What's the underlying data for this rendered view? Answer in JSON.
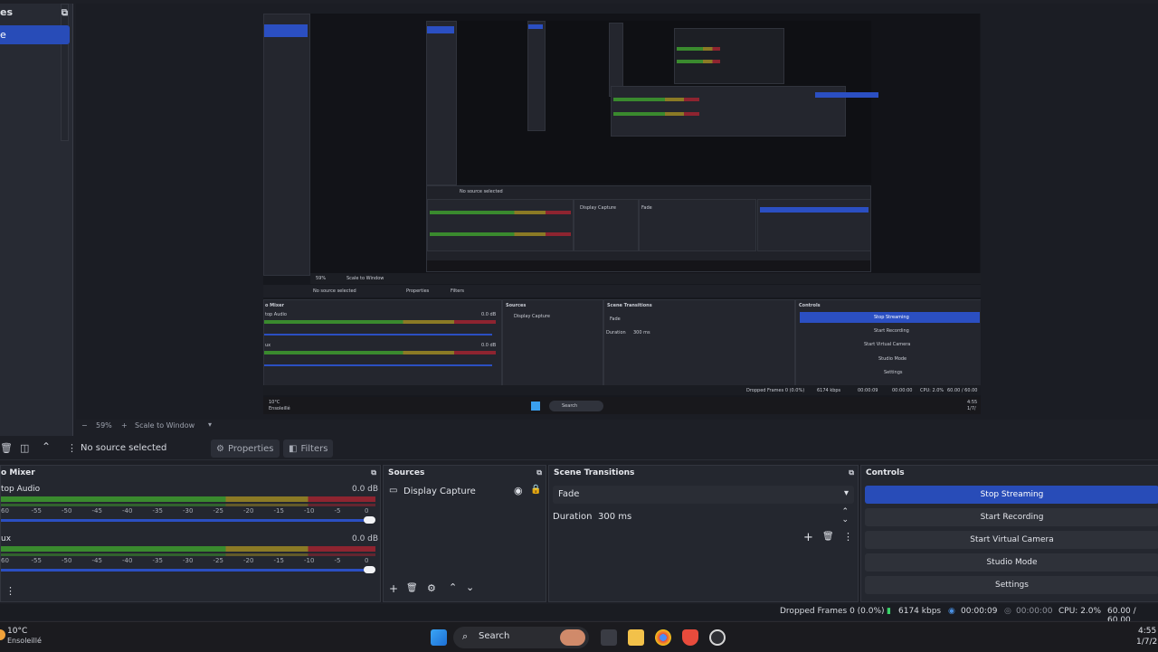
{
  "scenes": {
    "header": "es",
    "selected_item": "e",
    "dock_icon": "⧉"
  },
  "preview": {
    "inner": {
      "no_source": "No source selected",
      "properties": "Properties",
      "filters": "Filters",
      "zoom": "59%",
      "scale_to_window": "Scale to Window",
      "mixer_title": "o Mixer",
      "sources_title": "Sources",
      "scene_transitions_title": "Scene Transitions",
      "controls_title": "Controls",
      "desktop_audio": "top Audio",
      "aux": "ux",
      "db1": "0.0 dB",
      "db2": "0.0 dB",
      "display_capture": "Display Capture",
      "fade": "Fade",
      "duration_label": "Duration",
      "duration_value": "300 ms",
      "stop_streaming": "Stop Streaming",
      "start_recording": "Start Recording",
      "start_virtual_camera": "Start Virtual Camera",
      "studio_mode": "Studio Mode",
      "settings": "Settings",
      "status": "Dropped Frames 0 (0.0%)",
      "kbps": "6174 kbps",
      "time1": "00:00:09",
      "time2": "00:00:00",
      "cpu": "CPU: 2.0%",
      "fps": "60.00 / 60.00",
      "search": "Search",
      "weather_temp": "10°C",
      "weather_desc": "Ensoleillé",
      "clock_time": "4:55",
      "clock_date": "1/7/"
    }
  },
  "zoombar": {
    "minus": "−",
    "zoom": "59%",
    "plus": "+",
    "scale": "Scale to Window"
  },
  "source_toolbar": {
    "no_source": "No source selected",
    "properties": "Properties",
    "filters": "Filters"
  },
  "mixer": {
    "title": "o Mixer",
    "channels": [
      {
        "name": "top Audio",
        "db": "0.0 dB"
      },
      {
        "name": "ux",
        "db": "0.0 dB"
      }
    ],
    "scale": [
      "60",
      "-55",
      "-50",
      "-45",
      "-40",
      "-35",
      "-30",
      "-25",
      "-20",
      "-15",
      "-10",
      "-5",
      "0"
    ]
  },
  "sources": {
    "title": "Sources",
    "items": [
      {
        "name": "Display Capture"
      }
    ]
  },
  "transitions": {
    "title": "Scene Transitions",
    "type": "Fade",
    "duration_label": "Duration",
    "duration_value": "300 ms"
  },
  "controls": {
    "title": "Controls",
    "buttons": [
      "Stop Streaming",
      "Start Recording",
      "Start Virtual Camera",
      "Studio Mode",
      "Settings"
    ],
    "accent": "#284cb8"
  },
  "statusbar": {
    "dropped": "Dropped Frames 0 (0.0%)",
    "kbps": "6174 kbps",
    "stream_time": "00:00:09",
    "rec_time": "00:00:00",
    "cpu": "CPU: 2.0%",
    "fps": "60.00 / 60.00"
  },
  "taskbar": {
    "weather_temp": "10°C",
    "weather_desc": "Ensoleillé",
    "search": "Search",
    "time": "4:55",
    "date": "1/7/2"
  }
}
